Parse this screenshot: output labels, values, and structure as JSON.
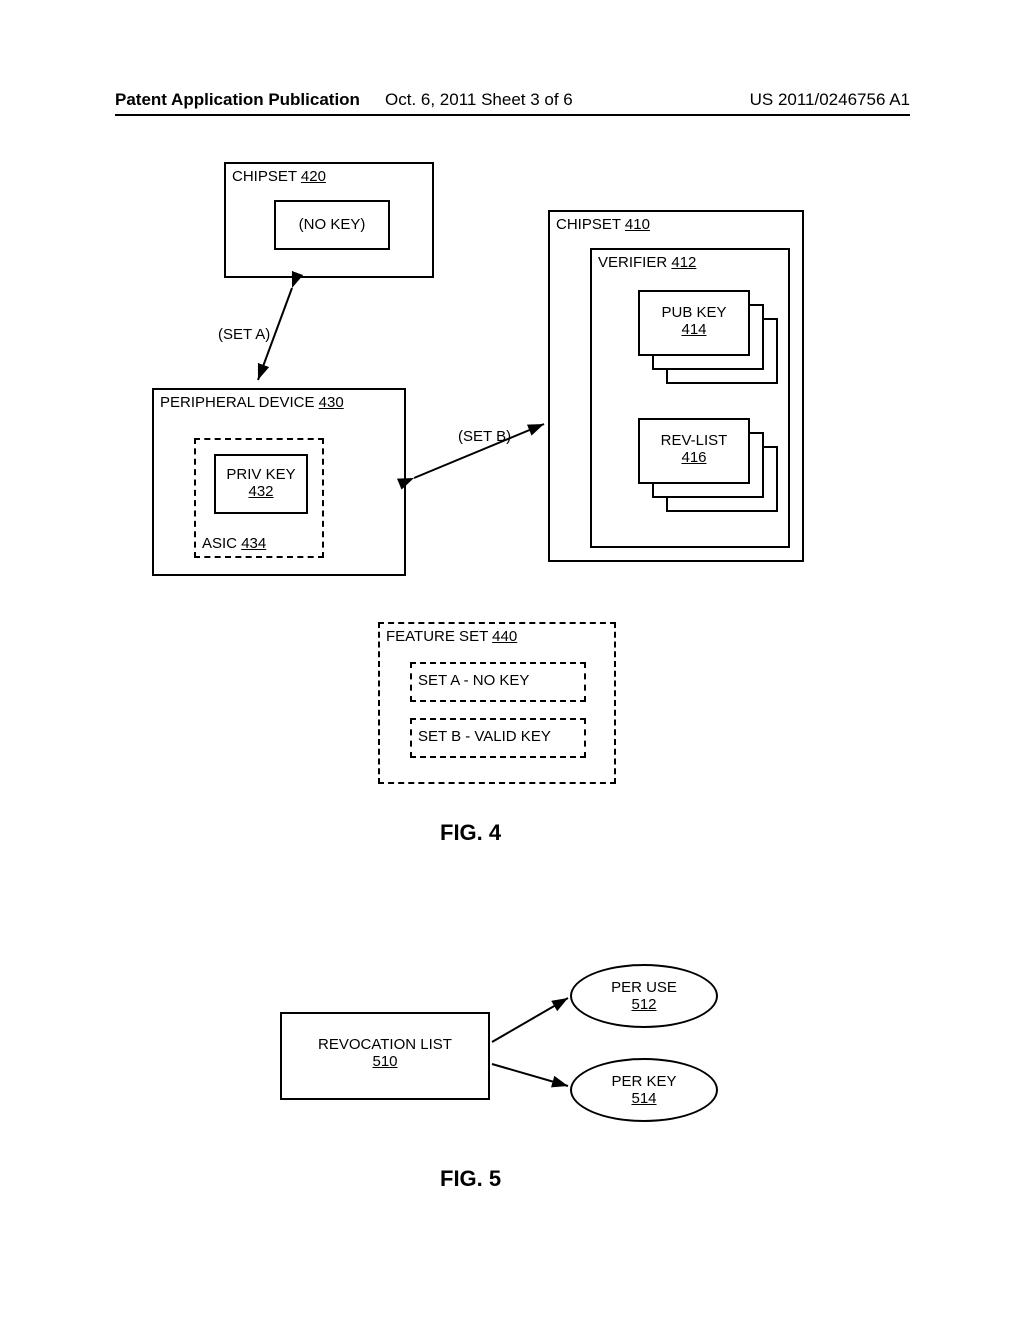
{
  "header": {
    "left": "Patent Application Publication",
    "center": "Oct. 6, 2011  Sheet 3 of 6",
    "right": "US 2011/0246756 A1"
  },
  "fig4": {
    "chipset420": {
      "title": "CHIPSET",
      "ref": "420",
      "nokey": "(NO KEY)"
    },
    "chipset410": {
      "title": "CHIPSET",
      "ref": "410"
    },
    "verifier": {
      "title": "VERIFIER",
      "ref": "412"
    },
    "pubkey": {
      "title": "PUB KEY",
      "ref": "414"
    },
    "revlist": {
      "title": "REV-LIST",
      "ref": "416"
    },
    "peripheral": {
      "title": "PERIPHERAL DEVICE",
      "ref": "430"
    },
    "asic": {
      "title": "ASIC",
      "ref": "434"
    },
    "privkey": {
      "title": "PRIV KEY",
      "ref": "432"
    },
    "setA": "(SET A)",
    "setB": "(SET B)",
    "featureset": {
      "title": "FEATURE SET",
      "ref": "440"
    },
    "setA_row": "SET A - NO KEY",
    "setB_row": "SET B - VALID KEY",
    "caption": "FIG. 4"
  },
  "fig5": {
    "revocation": {
      "title": "REVOCATION LIST",
      "ref": "510"
    },
    "peruse": {
      "title": "PER USE",
      "ref": "512"
    },
    "perkey": {
      "title": "PER KEY",
      "ref": "514"
    },
    "caption": "FIG. 5"
  }
}
